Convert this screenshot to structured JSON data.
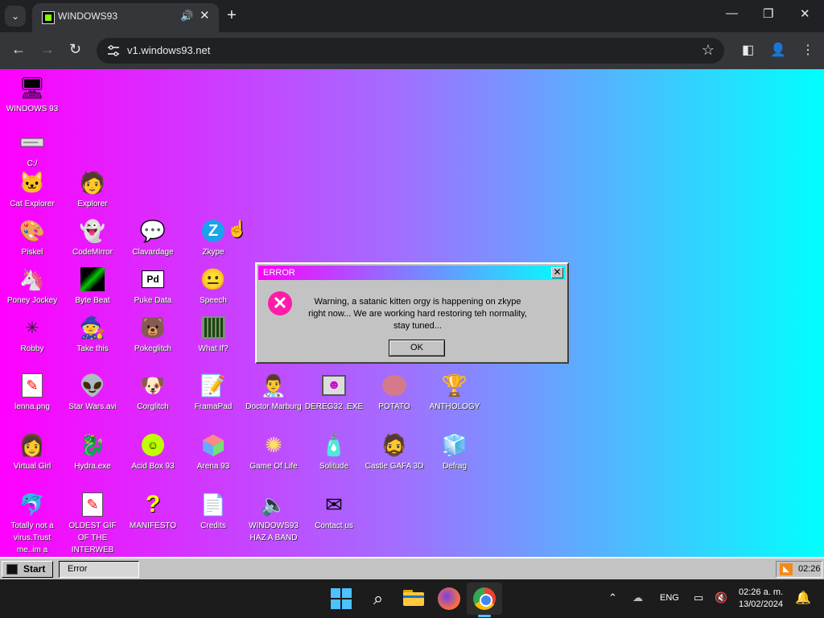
{
  "browser": {
    "tab_title": "WINDOWS93",
    "url": "v1.windows93.net"
  },
  "desktop": {
    "icons": [
      {
        "label": "WINDOWS 93",
        "icon": "computer-icon"
      },
      {
        "label": "C:/",
        "icon": "drive-icon"
      },
      {
        "label": "Cat Explorer",
        "icon": "cat-icon"
      },
      {
        "label": "Explorer",
        "icon": "explorer-icon"
      },
      {
        "label": "Piskel",
        "icon": "palette-icon"
      },
      {
        "label": "CodeMirror",
        "icon": "codemirror-icon"
      },
      {
        "label": "Clavardage",
        "icon": "chat-icon"
      },
      {
        "label": "Zkype",
        "icon": "zkype-icon"
      },
      {
        "label": "Poney Jockey",
        "icon": "pony-icon"
      },
      {
        "label": "Byte Beat",
        "icon": "bytebeat-icon"
      },
      {
        "label": "Puke Data",
        "icon": "pd-icon"
      },
      {
        "label": "Speech",
        "icon": "speech-icon"
      },
      {
        "label": "Robby",
        "icon": "robot-icon"
      },
      {
        "label": "Take this",
        "icon": "takethis-icon"
      },
      {
        "label": "Pokeglitch",
        "icon": "pokeglitch-icon"
      },
      {
        "label": "What If?",
        "icon": "whatif-icon"
      },
      {
        "label": "lenna.png",
        "icon": "image-file-icon"
      },
      {
        "label": "Star Wars.avi",
        "icon": "yoda-icon"
      },
      {
        "label": "Corglitch",
        "icon": "corgi-icon"
      },
      {
        "label": "FramaPad",
        "icon": "framapad-icon"
      },
      {
        "label": "Doctor Marburg",
        "icon": "doctor-icon"
      },
      {
        "label": "DEREG32 .EXE",
        "icon": "dereg-icon"
      },
      {
        "label": "POTATO",
        "icon": "potato-icon"
      },
      {
        "label": "ANTHOLOGY",
        "icon": "trophy-icon"
      },
      {
        "label": "Virtual Girl",
        "icon": "virtualgirl-icon"
      },
      {
        "label": "Hydra.exe",
        "icon": "hydra-icon"
      },
      {
        "label": "Acid Box 93",
        "icon": "smiley-icon"
      },
      {
        "label": "Arena 93",
        "icon": "cube-icon"
      },
      {
        "label": "Game Of Life",
        "icon": "gameoflife-icon"
      },
      {
        "label": "Solitude",
        "icon": "solitude-icon"
      },
      {
        "label": "Castle GAFA 3D",
        "icon": "castle-icon"
      },
      {
        "label": "Defrag",
        "icon": "defrag-icon"
      },
      {
        "label": "Totally not a virus.Trust me..im a",
        "icon": "dolphin-icon"
      },
      {
        "label": "OLDEST GIF OF THE INTERWEB",
        "icon": "gif-file-icon"
      },
      {
        "label": "MANIFESTO",
        "icon": "question-icon"
      },
      {
        "label": "Credits",
        "icon": "document-icon"
      },
      {
        "label": "WINDOWS93 HAZ A BAND",
        "icon": "speaker-icon"
      },
      {
        "label": "Contact us",
        "icon": "contact-icon"
      }
    ]
  },
  "dialog": {
    "title": "ERROR",
    "message": "Warning, a satanic kitten orgy is happening on zkype right now... We are working hard restoring teh normality, stay tuned...",
    "ok_label": "OK",
    "close_glyph": "✕"
  },
  "taskbar93": {
    "start_label": "Start",
    "task_label": "Error",
    "clock": "02:26"
  },
  "windows_taskbar": {
    "language": "ENG",
    "time": "02:26 a. m.",
    "date": "13/02/2024"
  },
  "colors": {
    "gradient_left": "#ff00ff",
    "gradient_mid": "#a36dff",
    "gradient_right": "#00ffff",
    "win_accent": "#4cc2ff"
  }
}
